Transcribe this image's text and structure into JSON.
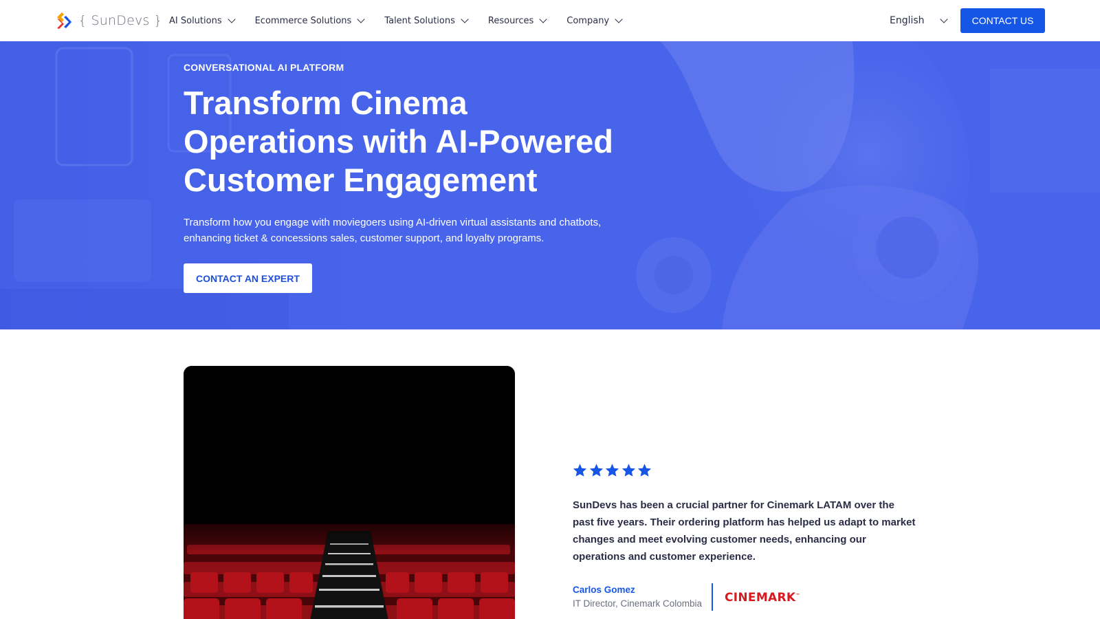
{
  "nav": {
    "logo_text": "{ SunDevs }",
    "items": [
      {
        "label": "AI Solutions"
      },
      {
        "label": "Ecommerce Solutions"
      },
      {
        "label": "Talent Solutions"
      },
      {
        "label": "Resources"
      },
      {
        "label": "Company"
      }
    ],
    "language": "English",
    "contact_label": "CONTACT US"
  },
  "hero": {
    "eyebrow": "CONVERSATIONAL AI PLATFORM",
    "title_lines": [
      "Transform Cinema",
      "Operations with AI-Powered",
      "Customer Engagement"
    ],
    "subtitle_lines": [
      "Transform how you engage with moviegoers using AI-driven virtual assistants and chatbots,",
      "enhancing ticket & concessions sales, customer support, and loyalty programs."
    ],
    "cta_label": "CONTACT AN EXPERT"
  },
  "testimonial": {
    "rating": 5,
    "quote_lines": [
      "SunDevs has been a crucial partner for Cinemark LATAM over the",
      "past five years. Their ordering platform has helped us adapt to market",
      "changes and meet evolving customer needs, enhancing our",
      "operations and customer experience."
    ],
    "author_name": "Carlos Gomez",
    "author_role": "IT Director, Cinemark Colombia",
    "client_logo_text": "CINEMARK"
  },
  "colors": {
    "brand_blue": "#1556e6",
    "hero_blue": "#4864ea",
    "cinemark_red": "#d71920",
    "seat_red": "#b3121b"
  },
  "icons": {
    "logo": "sundevs-chevron-logo-icon",
    "dropdown": "chevron-down-icon",
    "star": "star-icon"
  }
}
